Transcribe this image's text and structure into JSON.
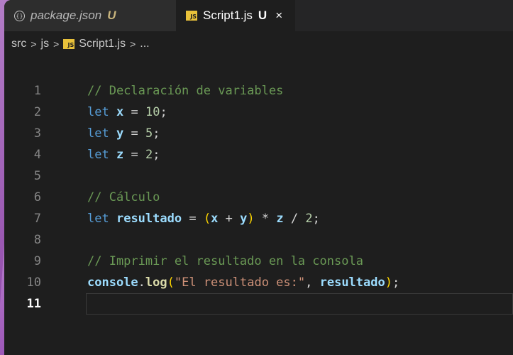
{
  "tabs": [
    {
      "name": "package.json",
      "status": "U",
      "icon": "json-icon"
    },
    {
      "name": "Script1.js",
      "status": "U",
      "icon": "js-icon",
      "active": true
    }
  ],
  "breadcrumb": {
    "parts": [
      "src",
      "js",
      "Script1.js",
      "..."
    ],
    "separator": ">"
  },
  "icons": {
    "js_label": "JS",
    "json_label": "{}",
    "close": "×"
  },
  "editor": {
    "lines": [
      {
        "n": "1",
        "text": "// Declaración de variables"
      },
      {
        "n": "2",
        "text": "let x = 10;"
      },
      {
        "n": "3",
        "text": "let y = 5;"
      },
      {
        "n": "4",
        "text": "let z = 2;"
      },
      {
        "n": "5",
        "text": ""
      },
      {
        "n": "6",
        "text": "// Cálculo"
      },
      {
        "n": "7",
        "text": "let resultado = (x + y) * z / 2;"
      },
      {
        "n": "8",
        "text": ""
      },
      {
        "n": "9",
        "text": "// Imprimir el resultado en la consola"
      },
      {
        "n": "10",
        "text": "console.log(\"El resultado es:\", resultado);"
      },
      {
        "n": "11",
        "text": ""
      }
    ],
    "current_line": "11"
  },
  "colors": {
    "background": "#1e1e1e",
    "comment": "#6a9955",
    "keyword": "#569cd6",
    "variable": "#9cdcfe",
    "number": "#b5cea8",
    "string": "#ce9178",
    "function": "#dcdcaa"
  }
}
